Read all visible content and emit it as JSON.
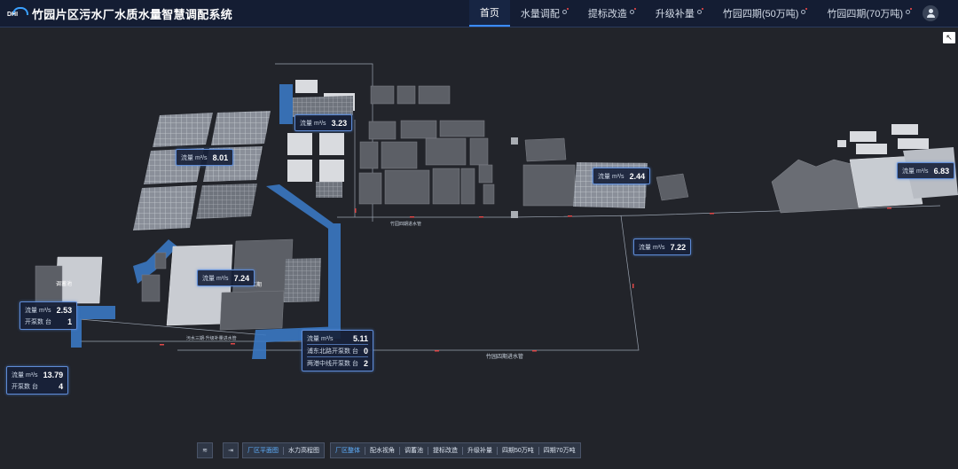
{
  "app": {
    "logo_text": "DHI",
    "title": "竹园片区污水厂水质水量智慧调配系统"
  },
  "nav": [
    {
      "label": "首页",
      "active": true,
      "dot": false
    },
    {
      "label": "水量调配",
      "active": false,
      "dot": true
    },
    {
      "label": "提标改造",
      "active": false,
      "dot": true
    },
    {
      "label": "升级补量",
      "active": false,
      "dot": true
    },
    {
      "label": "竹园四期(50万吨)",
      "active": false,
      "dot": true
    },
    {
      "label": "竹园四期(70万吨)",
      "active": false,
      "dot": true
    }
  ],
  "icons": {
    "user": "user-icon",
    "corner": "cursor-icon",
    "layers": "layers-icon",
    "collapse": "collapse-icon"
  },
  "colors": {
    "topbar_bg": "#141d33",
    "accent": "#3b8cff",
    "pipe_blue": "#3a78c2",
    "flow_red": "#e04848",
    "infobox_border": "#5e8bd6",
    "scene_bg": "#22242a"
  },
  "flows": {
    "box1": {
      "label": "流量 m³/s",
      "value": "8.01"
    },
    "box2": {
      "label": "流量 m³/s",
      "value": "3.23"
    },
    "box3": {
      "label": "流量 m³/s",
      "value": "2.44"
    },
    "box4": {
      "label": "流量 m³/s",
      "value": "6.83"
    },
    "box5": {
      "label": "流量 m³/s",
      "value": "7.22"
    },
    "box6": {
      "label": "流量 m³/s",
      "value": "7.24"
    },
    "box7": {
      "label": "流量 m³/s",
      "value": "2.53",
      "label2": "开泵数 台",
      "value2": "1"
    },
    "box8": {
      "label": "流量 m³/s",
      "value": "5.11",
      "label2": "浦东北路开泵数 台",
      "value2": "0",
      "label3": "两港中线开泵数 台",
      "value3": "2"
    },
    "box9": {
      "label": "流量 m³/s",
      "value": "13.79",
      "label2": "开泵数 台",
      "value2": "4"
    }
  },
  "pipe_labels": {
    "p1": "调蓄池",
    "p2": "竹园四期进水管",
    "p3": "竹园四期进水管",
    "p4": "污水三期·升级补量进水管",
    "p5": "二期"
  },
  "bottom": {
    "group1": [
      "厂区平面图",
      "水力高程图"
    ],
    "group2": [
      "厂区整体",
      "配水视角",
      "调蓄池",
      "提标改造",
      "升级补量",
      "四期50万吨",
      "四期70万吨"
    ]
  }
}
